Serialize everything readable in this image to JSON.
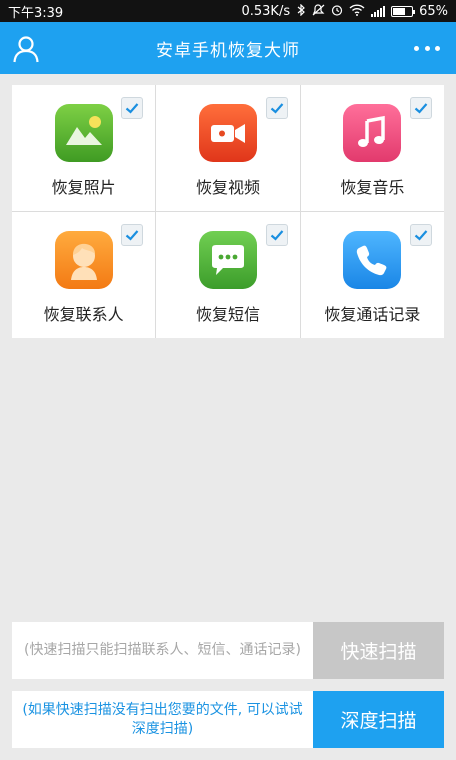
{
  "status_bar": {
    "time": "下午3:39",
    "speed": "0.53K/s",
    "battery_pct": "65%",
    "battery_level": 0.65,
    "icons": [
      "bluetooth-icon",
      "mute-icon",
      "alarm-icon",
      "wifi-icon",
      "signal-icon",
      "battery-icon"
    ]
  },
  "header": {
    "title": "安卓手机恢复大师",
    "left_icon": "user-icon",
    "right_icon": "more-icon"
  },
  "categories": [
    {
      "label": "恢复照片",
      "icon": "photo-icon",
      "checked": true
    },
    {
      "label": "恢复视频",
      "icon": "video-icon",
      "checked": true
    },
    {
      "label": "恢复音乐",
      "icon": "music-icon",
      "checked": true
    },
    {
      "label": "恢复联系人",
      "icon": "contact-icon",
      "checked": true
    },
    {
      "label": "恢复短信",
      "icon": "sms-icon",
      "checked": true
    },
    {
      "label": "恢复通话记录",
      "icon": "call-icon",
      "checked": true
    }
  ],
  "quick_scan": {
    "description": "(快速扫描只能扫描联系人、短信、通话记录)",
    "button": "快速扫描"
  },
  "deep_scan": {
    "description": "(如果快速扫描没有扫出您要的文件, 可以试试深度扫描)",
    "button": "深度扫描"
  },
  "colors": {
    "primary": "#1ea1f0",
    "check": "#1a8fe0",
    "disabled": "#c7c7c7"
  }
}
